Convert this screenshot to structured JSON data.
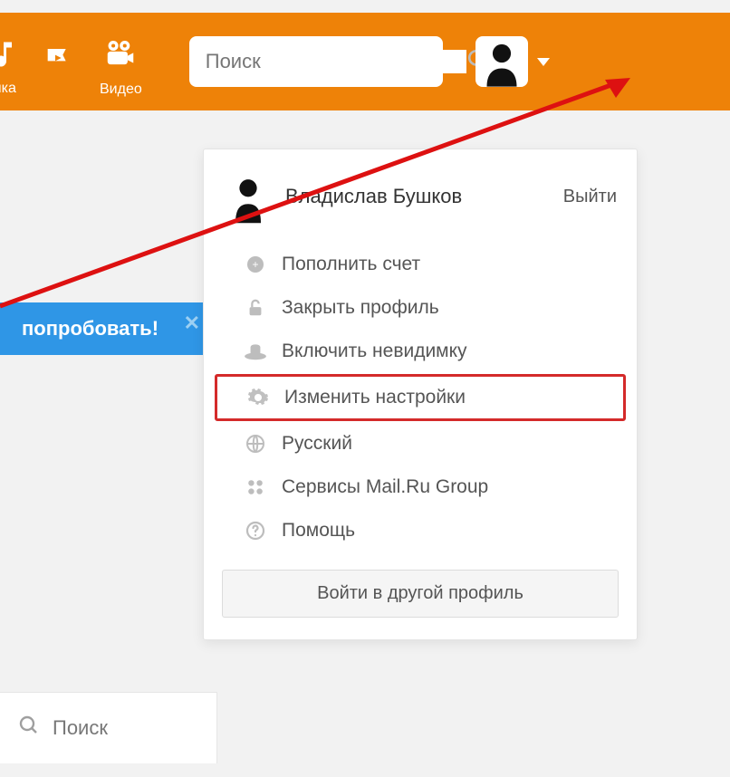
{
  "header": {
    "nav": [
      {
        "label": "ыка",
        "icon": "music-icon"
      },
      {
        "label": "",
        "icon": "play-flag-icon"
      },
      {
        "label": "Видео",
        "icon": "video-camera-icon"
      }
    ],
    "search_placeholder": "Поиск"
  },
  "banner": {
    "text": "попробовать!"
  },
  "dropdown": {
    "user_name": "Владислав Бушков",
    "logout_label": "Выйти",
    "items": [
      {
        "icon": "coins-icon",
        "label": "Пополнить счет"
      },
      {
        "icon": "lock-open-icon",
        "label": "Закрыть профиль"
      },
      {
        "icon": "hat-icon",
        "label": "Включить невидимку"
      },
      {
        "icon": "gear-icon",
        "label": "Изменить настройки",
        "highlighted": true
      },
      {
        "icon": "globe-icon",
        "label": "Русский"
      },
      {
        "icon": "grid-icon",
        "label": "Сервисы Mail.Ru Group"
      },
      {
        "icon": "help-icon",
        "label": "Помощь"
      }
    ],
    "login_other_label": "Войти в другой профиль"
  },
  "bottom_search_label": "Поиск"
}
